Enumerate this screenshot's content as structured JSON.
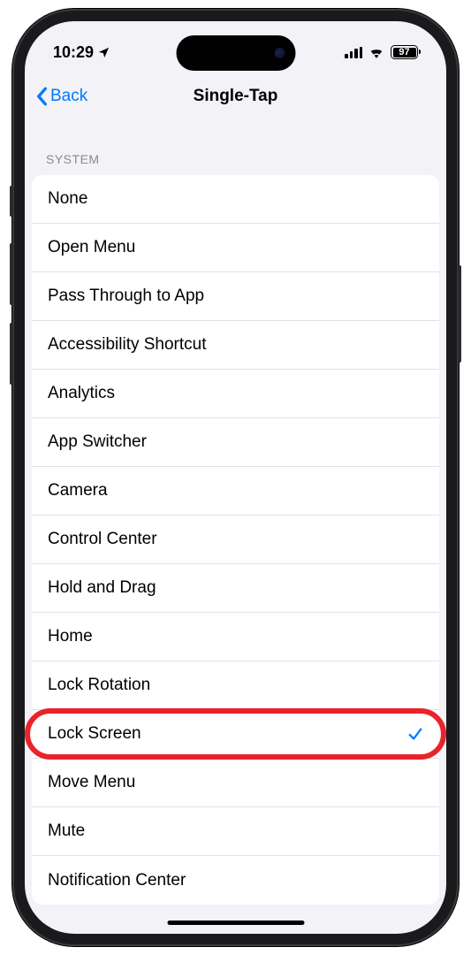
{
  "status_bar": {
    "time": "10:29",
    "battery": "97"
  },
  "nav": {
    "back_label": "Back",
    "title": "Single-Tap"
  },
  "section": {
    "header": "SYSTEM",
    "items": [
      {
        "label": "None",
        "selected": false,
        "highlighted": false
      },
      {
        "label": "Open Menu",
        "selected": false,
        "highlighted": false
      },
      {
        "label": "Pass Through to App",
        "selected": false,
        "highlighted": false
      },
      {
        "label": "Accessibility Shortcut",
        "selected": false,
        "highlighted": false
      },
      {
        "label": "Analytics",
        "selected": false,
        "highlighted": false
      },
      {
        "label": "App Switcher",
        "selected": false,
        "highlighted": false
      },
      {
        "label": "Camera",
        "selected": false,
        "highlighted": false
      },
      {
        "label": "Control Center",
        "selected": false,
        "highlighted": false
      },
      {
        "label": "Hold and Drag",
        "selected": false,
        "highlighted": false
      },
      {
        "label": "Home",
        "selected": false,
        "highlighted": false
      },
      {
        "label": "Lock Rotation",
        "selected": false,
        "highlighted": false
      },
      {
        "label": "Lock Screen",
        "selected": true,
        "highlighted": true
      },
      {
        "label": "Move Menu",
        "selected": false,
        "highlighted": false
      },
      {
        "label": "Mute",
        "selected": false,
        "highlighted": false
      },
      {
        "label": "Notification Center",
        "selected": false,
        "highlighted": false
      }
    ]
  }
}
